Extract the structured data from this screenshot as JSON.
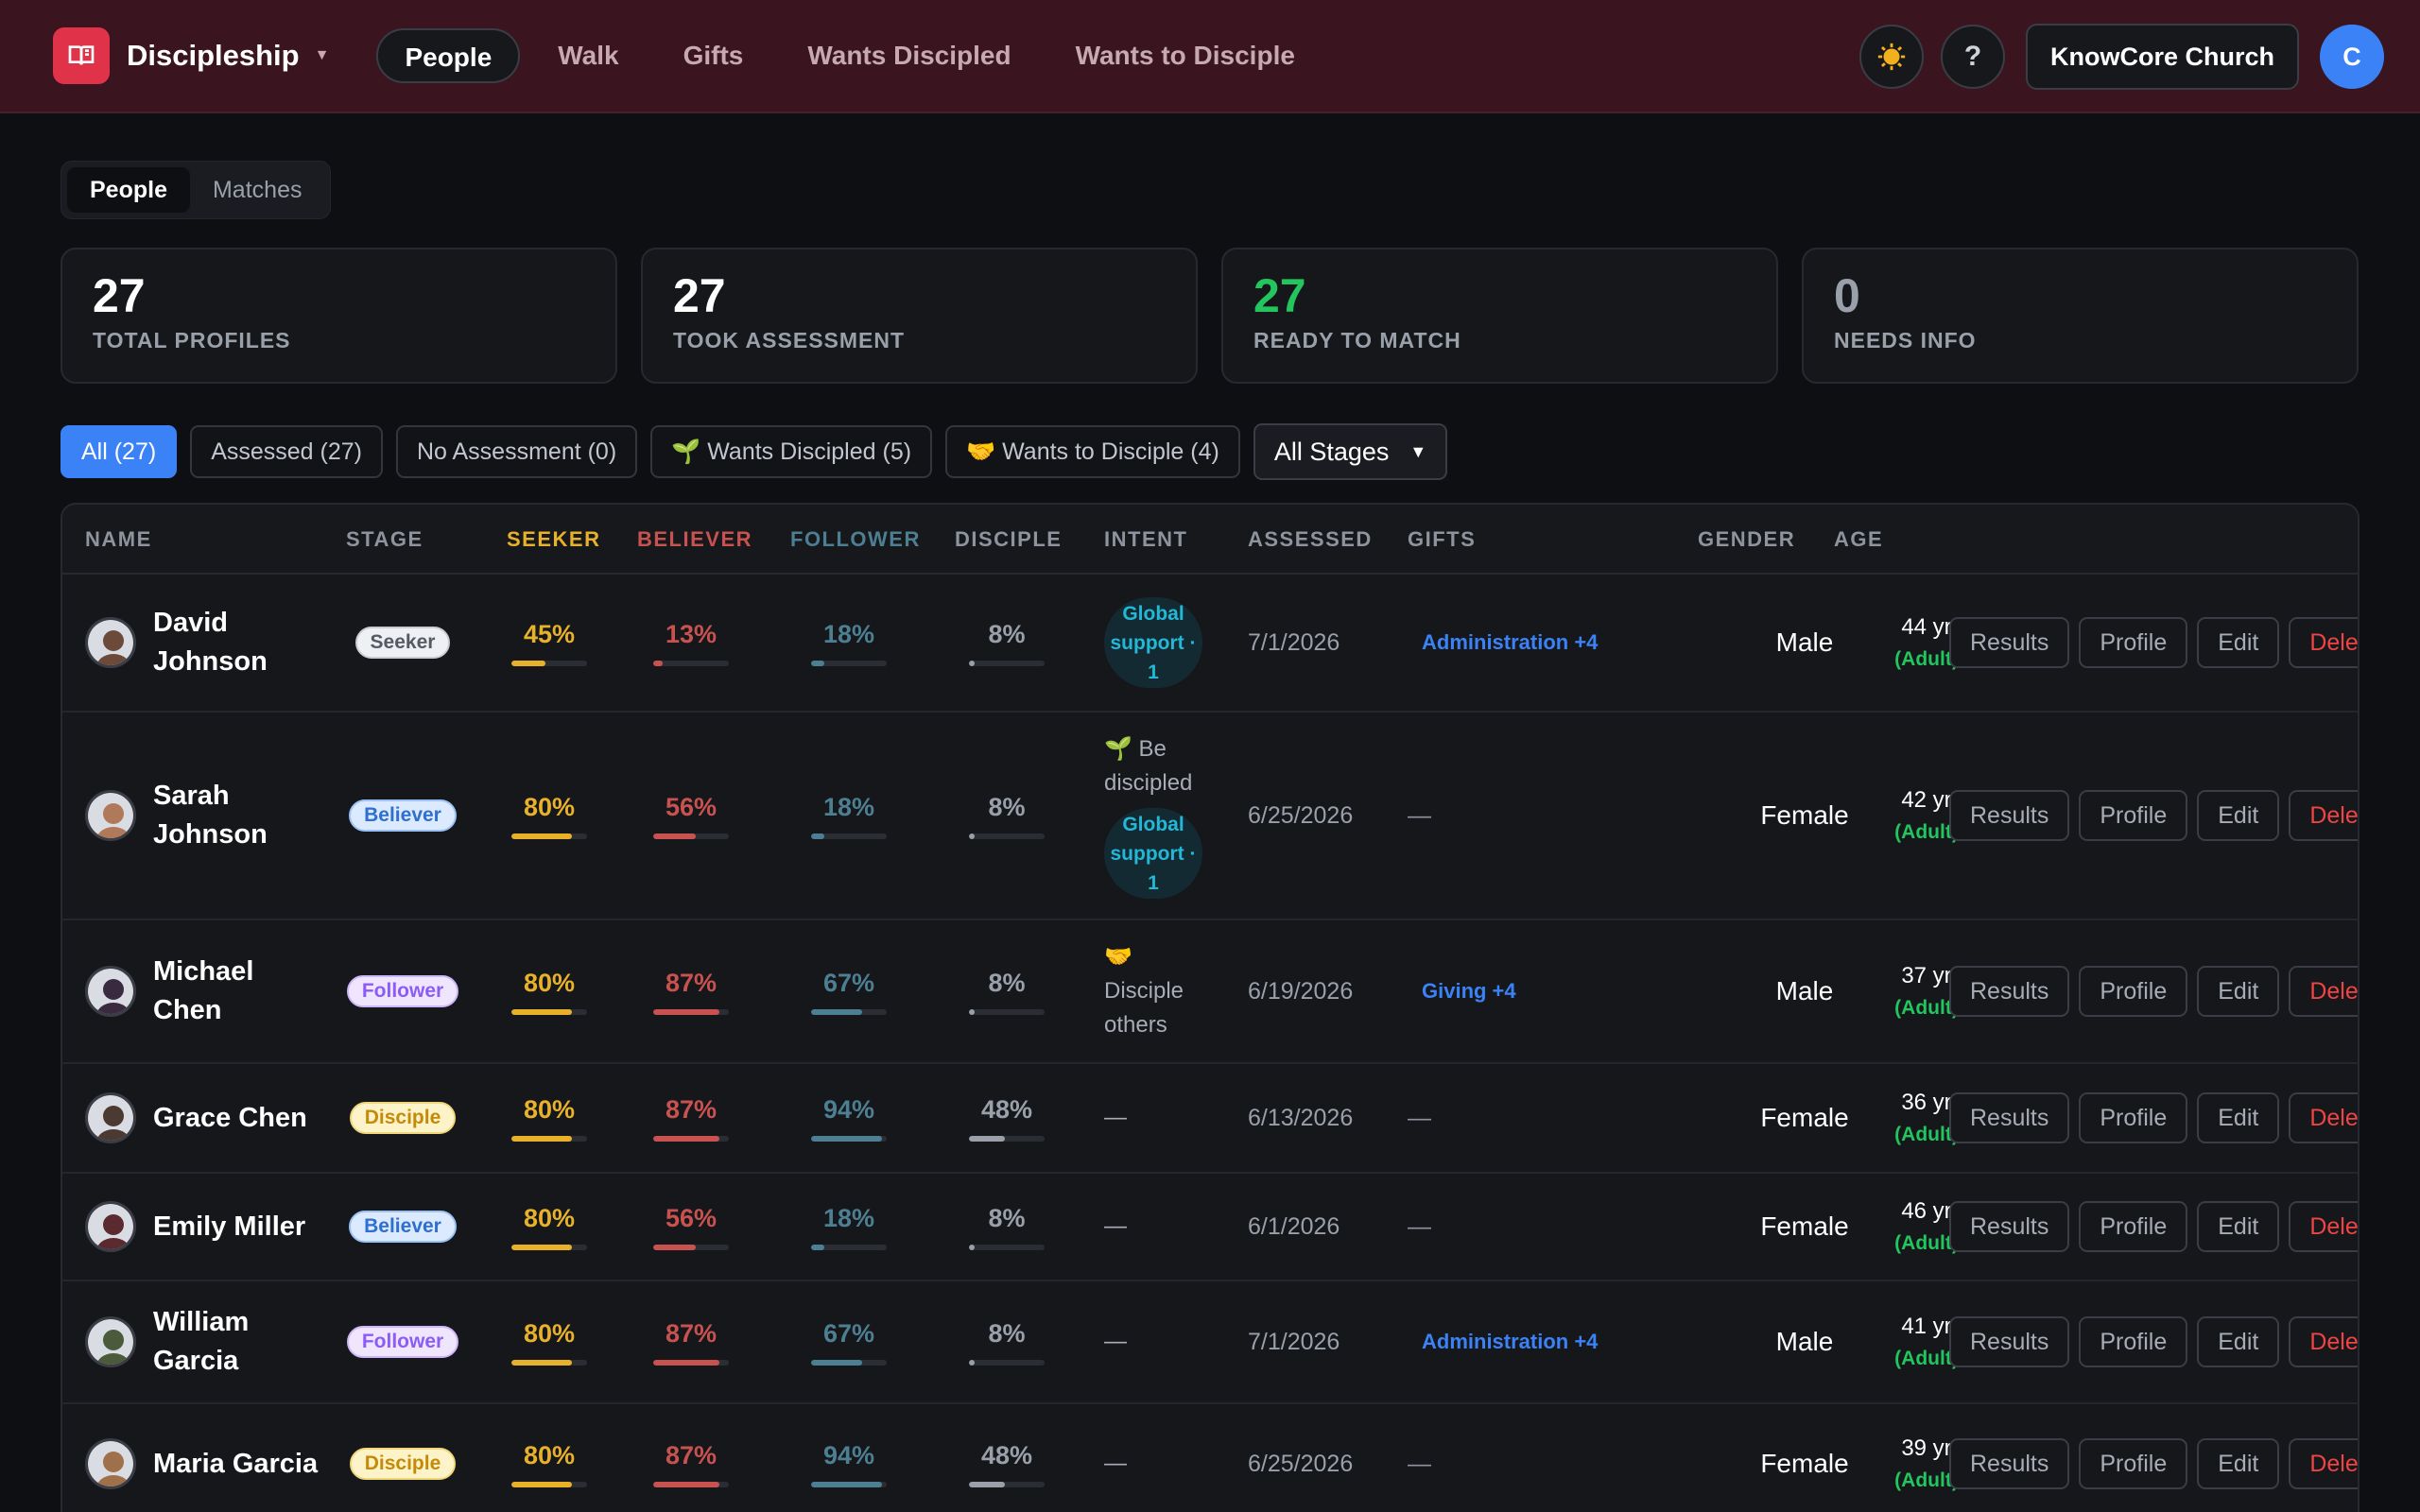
{
  "app": {
    "name": "Discipleship"
  },
  "nav": [
    "People",
    "Walk",
    "Gifts",
    "Wants Discipled",
    "Wants to Disciple"
  ],
  "header": {
    "help_label": "?",
    "org_name": "KnowCore Church",
    "avatar_initial": "C"
  },
  "subtabs": [
    "People",
    "Matches"
  ],
  "stats": [
    {
      "value": "27",
      "label": "TOTAL PROFILES"
    },
    {
      "value": "27",
      "label": "TOOK ASSESSMENT"
    },
    {
      "value": "27",
      "label": "READY TO MATCH"
    },
    {
      "value": "0",
      "label": "NEEDS INFO"
    }
  ],
  "filters": [
    "All (27)",
    "Assessed (27)",
    "No Assessment (0)",
    "🌱 Wants Discipled (5)",
    "🤝 Wants to Disciple (4)"
  ],
  "stage_select": "All Stages",
  "columns": [
    "NAME",
    "STAGE",
    "SEEKER",
    "BELIEVER",
    "FOLLOWER",
    "DISCIPLE",
    "INTENT",
    "ASSESSED",
    "GIFTS",
    "GENDER",
    "AGE"
  ],
  "colors": {
    "seeker": "#e8b12a",
    "believer": "#c8524f",
    "follower": "#4d7f92",
    "disciple": "#9aa0aa",
    "accent": "#3b82f6",
    "green": "#22c55e"
  },
  "actions": {
    "results": "Results",
    "profile": "Profile",
    "edit": "Edit",
    "delete": "Delet"
  },
  "people": [
    {
      "name": "David Johnson",
      "stage": "Seeker",
      "seeker": "45%",
      "believer": "13%",
      "follower": "18%",
      "disciple": "8%",
      "intent_text": "",
      "intent_pill": "Global support · 1",
      "assessed": "7/1/2026",
      "gifts": "Administration +4",
      "gender": "Male",
      "age": "44 yr",
      "age_group": "(Adult)"
    },
    {
      "name": "Sarah Johnson",
      "stage": "Believer",
      "seeker": "80%",
      "believer": "56%",
      "follower": "18%",
      "disciple": "8%",
      "intent_text": "🌱 Be discipled",
      "intent_pill": "Global support · 1",
      "assessed": "6/25/2026",
      "gifts": "—",
      "gender": "Female",
      "age": "42 yr",
      "age_group": "(Adult)"
    },
    {
      "name": "Michael Chen",
      "stage": "Follower",
      "seeker": "80%",
      "believer": "87%",
      "follower": "67%",
      "disciple": "8%",
      "intent_text": "🤝 Disciple others",
      "intent_pill": "",
      "assessed": "6/19/2026",
      "gifts": "Giving +4",
      "gender": "Male",
      "age": "37 yr",
      "age_group": "(Adult)"
    },
    {
      "name": "Grace Chen",
      "stage": "Disciple",
      "seeker": "80%",
      "believer": "87%",
      "follower": "94%",
      "disciple": "48%",
      "intent_text": "—",
      "intent_pill": "",
      "assessed": "6/13/2026",
      "gifts": "—",
      "gender": "Female",
      "age": "36 yr",
      "age_group": "(Adult)"
    },
    {
      "name": "Emily Miller",
      "stage": "Believer",
      "seeker": "80%",
      "believer": "56%",
      "follower": "18%",
      "disciple": "8%",
      "intent_text": "—",
      "intent_pill": "",
      "assessed": "6/1/2026",
      "gifts": "—",
      "gender": "Female",
      "age": "46 yr",
      "age_group": "(Adult)"
    },
    {
      "name": "William Garcia",
      "stage": "Follower",
      "seeker": "80%",
      "believer": "87%",
      "follower": "67%",
      "disciple": "8%",
      "intent_text": "—",
      "intent_pill": "",
      "assessed": "7/1/2026",
      "gifts": "Administration +4",
      "gender": "Male",
      "age": "41 yr",
      "age_group": "(Adult)"
    },
    {
      "name": "Maria Garcia",
      "stage": "Disciple",
      "seeker": "80%",
      "believer": "87%",
      "follower": "94%",
      "disciple": "48%",
      "intent_text": "—",
      "intent_pill": "",
      "assessed": "6/25/2026",
      "gifts": "—",
      "gender": "Female",
      "age": "39 yr",
      "age_group": "(Adult)"
    }
  ]
}
